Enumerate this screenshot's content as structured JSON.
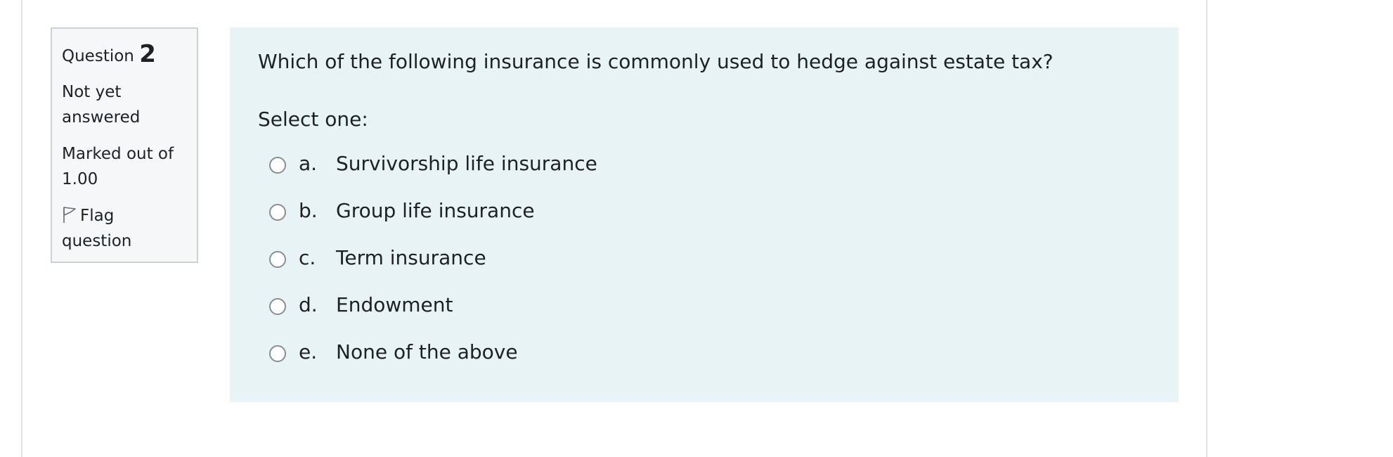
{
  "info": {
    "question_label": "Question",
    "question_number": "2",
    "state_line1": "Not yet",
    "state_line2": "answered",
    "grade_line1": "Marked out of",
    "grade_line2": "1.00",
    "flag_line1": "Flag",
    "flag_line2": "question"
  },
  "question": {
    "text": "Which of the following insurance is commonly used to hedge against estate tax?",
    "prompt": "Select one:",
    "options": [
      {
        "letter": "a.",
        "text": "Survivorship life insurance"
      },
      {
        "letter": "b.",
        "text": "Group life insurance"
      },
      {
        "letter": "c.",
        "text": "Term insurance"
      },
      {
        "letter": "d.",
        "text": "Endowment"
      },
      {
        "letter": "e.",
        "text": "None of the above"
      }
    ]
  },
  "colors": {
    "info_bg": "#f5f7f9",
    "question_bg": "#e7f3f5",
    "text": "#1d2125"
  },
  "icons": {
    "flag": "flag-outline-icon",
    "radio": "radio-unchecked-icon"
  }
}
